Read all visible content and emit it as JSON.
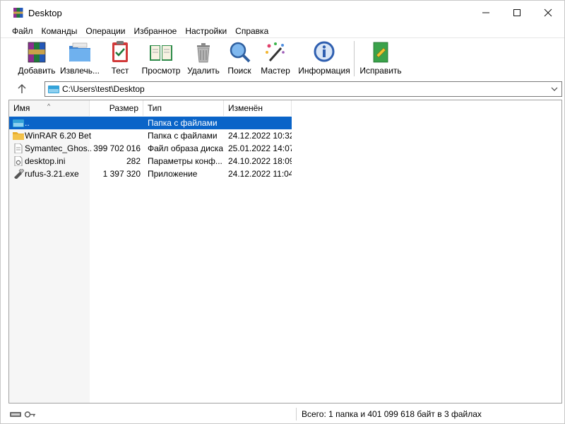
{
  "window": {
    "title": "Desktop"
  },
  "menu": [
    "Файл",
    "Команды",
    "Операции",
    "Избранное",
    "Настройки",
    "Справка"
  ],
  "toolbar": {
    "add": "Добавить",
    "extract": "Извлечь...",
    "test": "Тест",
    "view": "Просмотр",
    "delete": "Удалить",
    "find": "Поиск",
    "wizard": "Мастер",
    "info": "Информация",
    "repair": "Исправить"
  },
  "address": {
    "path": "C:\\Users\\test\\Desktop"
  },
  "columns": {
    "name": "Имя",
    "size": "Размер",
    "type": "Тип",
    "modified": "Изменён"
  },
  "files": [
    {
      "name": "..",
      "size": "",
      "type": "Папка с файлами",
      "modified": "",
      "icon": "drive-folder-icon"
    },
    {
      "name": "WinRAR 6.20 Bet...",
      "size": "",
      "type": "Папка с файлами",
      "modified": "24.12.2022 10:32",
      "icon": "folder-icon"
    },
    {
      "name": "Symantec_Ghos...",
      "size": "399 702 016",
      "type": "Файл образа диска",
      "modified": "25.01.2022 14:07",
      "icon": "file-icon"
    },
    {
      "name": "desktop.ini",
      "size": "282",
      "type": "Параметры конф...",
      "modified": "24.10.2022 18:09",
      "icon": "settings-file-icon"
    },
    {
      "name": "rufus-3.21.exe",
      "size": "1 397 320",
      "type": "Приложение",
      "modified": "24.12.2022 11:04",
      "icon": "usb-app-icon"
    }
  ],
  "status": {
    "text": "Всего: 1 папка и 401 099 618 байт в 3 файлах"
  },
  "colors": {
    "selection": "#0a64c8",
    "folder": "#f3c24a"
  }
}
